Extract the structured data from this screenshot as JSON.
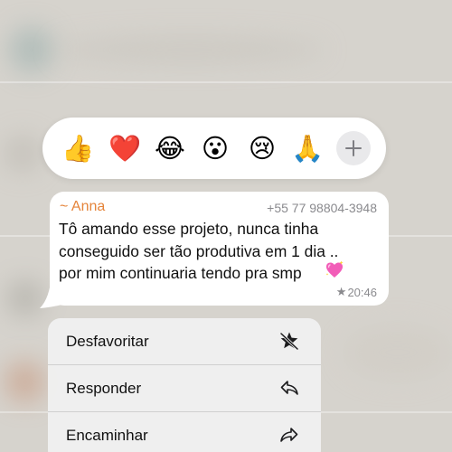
{
  "reactions": [
    {
      "name": "thumbs-up",
      "glyph": "👍"
    },
    {
      "name": "red-heart",
      "glyph": "❤️",
      "selected": true
    },
    {
      "name": "laughing-tears",
      "glyph": "😂"
    },
    {
      "name": "surprised",
      "glyph": "😮"
    },
    {
      "name": "crying",
      "glyph": "😢"
    },
    {
      "name": "praying-hands",
      "glyph": "🙏"
    }
  ],
  "add_reaction_icon": "plus-icon",
  "message": {
    "sender": "~ Anna",
    "phone": "+55 77 98804-3948",
    "lines": [
      "Tô amando esse projeto, nunca tinha",
      "conseguido ser tão produtiva em 1 dia ..",
      "por mim continuaria tendo pra smp"
    ],
    "trailing_emoji": "sparkling-heart-icon",
    "star": "★",
    "time": "20:46"
  },
  "menu": {
    "items": [
      {
        "label": "Desfavoritar",
        "icon": "unstar-icon"
      },
      {
        "label": "Responder",
        "icon": "reply-icon"
      },
      {
        "label": "Encaminhar",
        "icon": "forward-icon"
      }
    ]
  },
  "colors": {
    "sender": "#e5843a",
    "meta": "#8a8a8e",
    "bubble": "#ffffff",
    "menu_bg": "#f0f0f0"
  }
}
